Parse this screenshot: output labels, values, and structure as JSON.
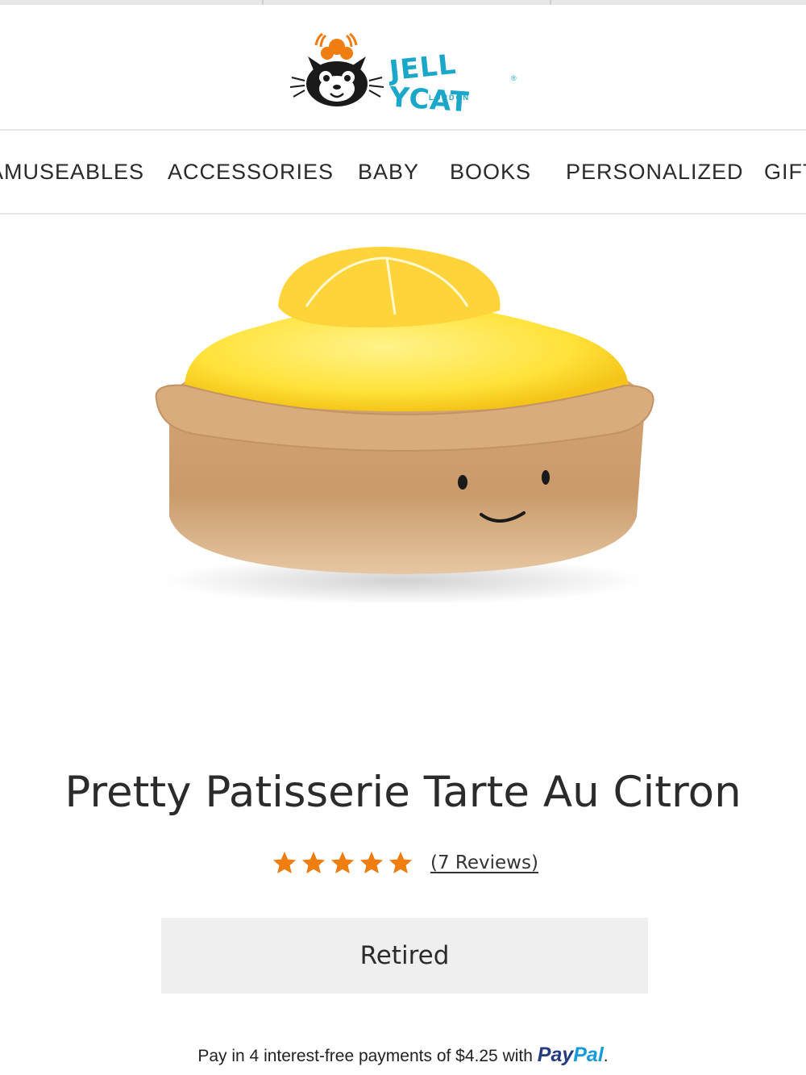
{
  "brand": {
    "name": "JELLYCAT",
    "name_part1": "JELL",
    "name_part2": "YCAT",
    "registered": "®",
    "subtitle": "LONDON",
    "color": "#1aa7c9"
  },
  "nav": {
    "items": [
      "AMUSEABLES",
      "ACCESSORIES",
      "BABY",
      "BOOKS",
      "PERSONALIZED",
      "GIFTS"
    ]
  },
  "product": {
    "title": "Pretty Patisserie Tarte Au Citron",
    "rating": 5,
    "rating_color": "#f07d10",
    "reviews_label": "(7 Reviews)",
    "status": "Retired"
  },
  "payment": {
    "text": "Pay in 4 interest-free payments of $4.25 with",
    "brand_pay": "Pay",
    "brand_pal": "Pal",
    "suffix": "."
  }
}
